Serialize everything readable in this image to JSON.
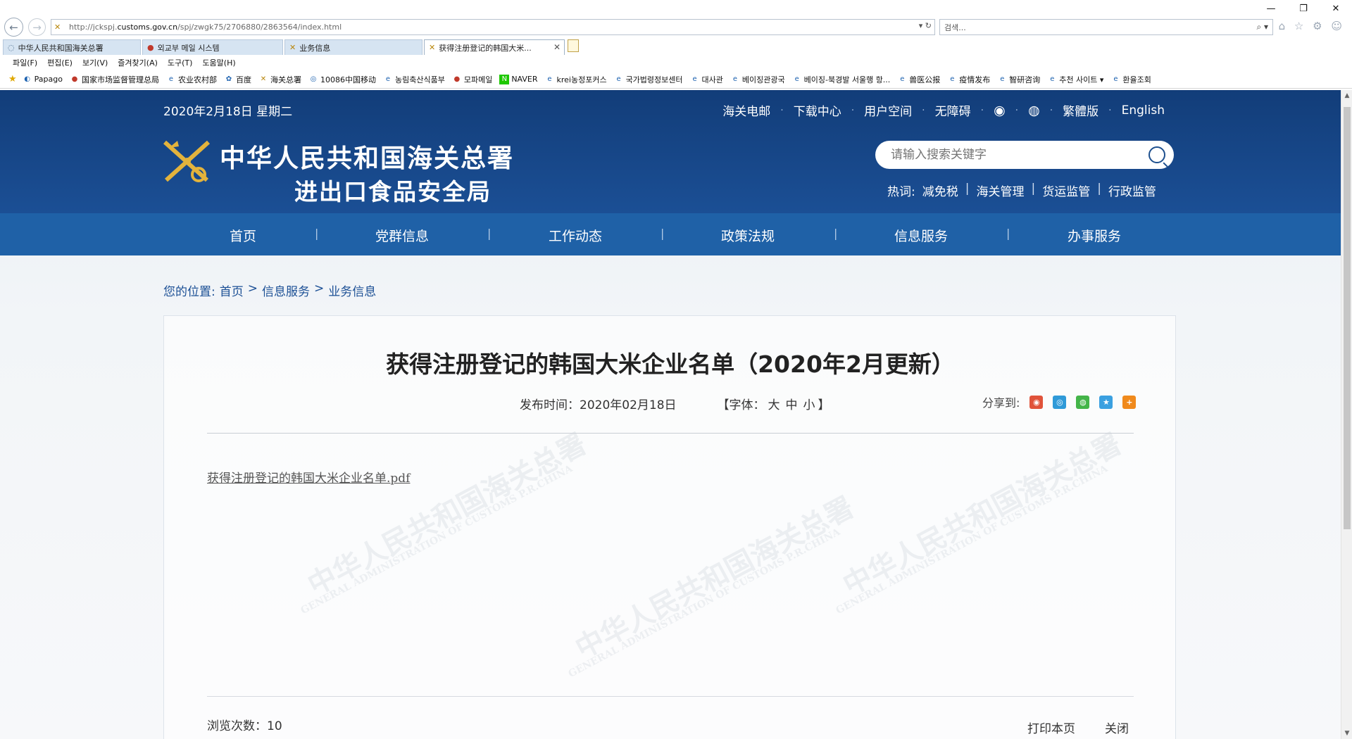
{
  "browser": {
    "window_controls": [
      "—",
      "❐",
      "✕"
    ],
    "url_host_pre": "http://jckspj.",
    "url_host": "customs.gov.cn",
    "url_path": "/spj/zwgk75/2706880/2863564/index.html",
    "addr_tools": "▾ ↻",
    "search_placeholder": "검색...",
    "search_tools": "⌕ ▾",
    "chrome_icons": "⌂ ☆ ⚙ ☺",
    "tabs": [
      {
        "label": "中华人民共和国海关总署",
        "active": false
      },
      {
        "label": "외교부 메일 시스템",
        "active": false
      },
      {
        "label": "业务信息",
        "active": false
      },
      {
        "label": "获得注册登记的韩国大米...",
        "active": true
      }
    ],
    "menu": [
      "파일(F)",
      "편집(E)",
      "보기(V)",
      "즐겨찾기(A)",
      "도구(T)",
      "도움말(H)"
    ],
    "favorites": [
      "Papago",
      "国家市场监督管理总局",
      "农业农村部",
      "百度",
      "海关总署",
      "10086中国移动",
      "농림축산식품부",
      "모파메일",
      "NAVER",
      "krei농정포커스",
      "국가법령정보센터",
      "대사관",
      "베이징관광국",
      "베이징-북경발 서울행 항...",
      "兽医公报",
      "疫情发布",
      "智研咨询",
      "추천 사이트 ▾",
      "환율조회"
    ]
  },
  "site": {
    "date": "2020年2月18日 星期二",
    "top_links": [
      "海关电邮",
      "下载中心",
      "用户空间",
      "无障碍",
      "繁體版",
      "English"
    ],
    "logo_line1": "中华人民共和国海关总署",
    "logo_line2": "进出口食品安全局",
    "search_placeholder": "请输入搜索关键字",
    "hotwords_label": "热词:",
    "hotwords": [
      "减免税",
      "海关管理",
      "货运监管",
      "行政监管"
    ],
    "nav": [
      "首页",
      "党群信息",
      "工作动态",
      "政策法规",
      "信息服务",
      "办事服务"
    ],
    "nav_sep": "|",
    "breadcrumb": [
      "您的位置:",
      "首页",
      ">",
      "信息服务",
      ">",
      "业务信息"
    ]
  },
  "article": {
    "title": "获得注册登记的韩国大米企业名单（2020年2月更新）",
    "publish": "发布时间：2020年02月18日",
    "font_label_open": "【字体：",
    "font_sizes": [
      "大",
      "中",
      "小"
    ],
    "font_label_close": "】",
    "share_label": "分享到:",
    "attachment": "获得注册登记的韩国大米企业名单.pdf",
    "watermark_cn": "中华人民共和国海关总署",
    "watermark_en": "GENERAL ADMINISTRATION OF CUSTOMS P.R.CHINA",
    "views": "浏览次数：10",
    "print": "打印本页",
    "close": "关闭"
  },
  "colors": {
    "header_blue": "#1b4f95",
    "nav_blue": "#1f61a7",
    "link_blue": "#1b4f95"
  }
}
